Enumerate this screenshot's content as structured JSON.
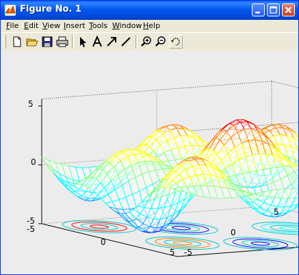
{
  "window": {
    "title": "Figure No. 1",
    "title_color": "#ffffff",
    "titlebar_color": "#0054e3"
  },
  "menu": {
    "items": [
      "File",
      "Edit",
      "View",
      "Insert",
      "Tools",
      "Window",
      "Help"
    ]
  },
  "toolbar": {
    "tools": [
      "new-figure-icon",
      "open-file-icon",
      "save-icon",
      "print-icon",
      "select-arrow-icon",
      "text-insert-icon",
      "arrow-insert-icon",
      "line-insert-icon",
      "zoom-in-icon",
      "zoom-out-icon",
      "rotate-3d-icon"
    ]
  },
  "plot": {
    "z_ticks": [
      "5",
      "0",
      "-5"
    ],
    "x_ticks": [
      "-5",
      "0",
      "5"
    ],
    "y_ticks": [
      "-5",
      "0",
      "5"
    ],
    "colormap": [
      "#0000ff",
      "#00a0ff",
      "#00ffff",
      "#80ff80",
      "#ffff00",
      "#ff8000",
      "#ff0000"
    ],
    "contour_floor": true
  }
}
